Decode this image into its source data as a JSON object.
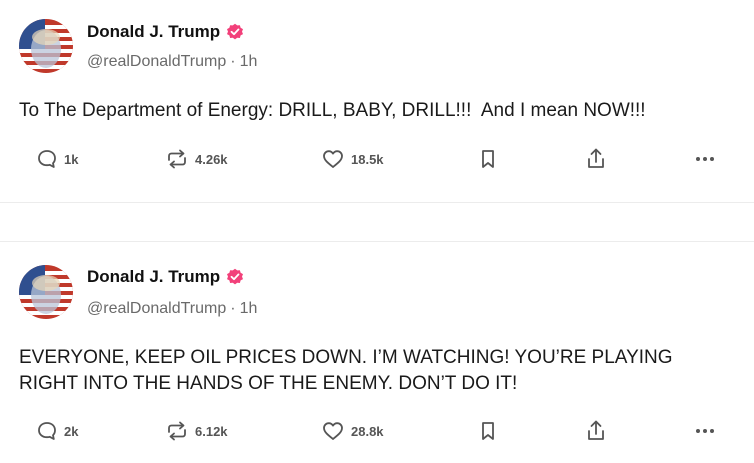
{
  "colors": {
    "verified_badge": "#f2407a",
    "text_primary": "#111111",
    "text_secondary": "#6a6a6a",
    "icon": "#555555"
  },
  "posts": [
    {
      "author_name": "Donald J. Trump",
      "handle": "@realDonaldTrump",
      "separator": "·",
      "time": "1h",
      "text": "To The Department of Energy: DRILL, BABY, DRILL!!!  And I mean NOW!!!",
      "replies": "1k",
      "reposts": "4.26k",
      "likes": "18.5k"
    },
    {
      "author_name": "Donald J. Trump",
      "handle": "@realDonaldTrump",
      "separator": "·",
      "time": "1h",
      "text": "EVERYONE, KEEP OIL PRICES DOWN. I’M WATCHING! YOU’RE PLAYING\nRIGHT INTO THE HANDS OF THE ENEMY. DON’T DO IT!",
      "replies": "2k",
      "reposts": "6.12k",
      "likes": "28.8k"
    }
  ],
  "icons": {
    "reply": "speech-bubble-icon",
    "repost": "repost-arrows-icon",
    "like": "heart-icon",
    "bookmark": "bookmark-icon",
    "share": "share-upload-icon",
    "more": "more-dots-icon",
    "verified": "verified-badge-icon"
  }
}
